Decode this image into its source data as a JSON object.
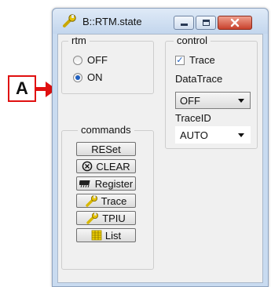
{
  "callout": {
    "label": "A"
  },
  "window": {
    "title": "B::RTM.state",
    "controls": [
      "minimize",
      "maximize",
      "close"
    ]
  },
  "rtm": {
    "legend": "rtm",
    "options": [
      {
        "label": "OFF",
        "selected": false
      },
      {
        "label": "ON",
        "selected": true
      }
    ]
  },
  "control": {
    "legend": "control",
    "trace_checkbox": {
      "label": "Trace",
      "checked": true
    },
    "datatrace": {
      "legend": "DataTrace",
      "value": "OFF"
    },
    "traceid": {
      "legend": "TraceID",
      "value": "AUTO"
    }
  },
  "commands": {
    "legend": "commands",
    "buttons": [
      {
        "label": "RESet",
        "icon": "none"
      },
      {
        "label": "CLEAR",
        "icon": "clear-circle-x-icon"
      },
      {
        "label": "Register",
        "icon": "chip-icon"
      },
      {
        "label": "Trace",
        "icon": "wrench-icon"
      },
      {
        "label": "TPIU",
        "icon": "wrench-icon"
      },
      {
        "label": "List",
        "icon": "grid-icon"
      }
    ]
  },
  "colors": {
    "accent": "#1f5fbf",
    "callout": "#e01010",
    "wrench": "#e0c000"
  }
}
